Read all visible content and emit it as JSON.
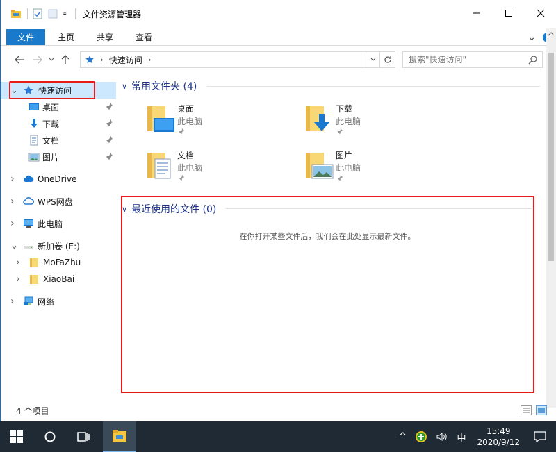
{
  "window": {
    "title": "文件资源管理器",
    "controls": {
      "minimize": "—",
      "maximize": "☐",
      "close": "✕"
    }
  },
  "ribbon": {
    "tabs": [
      "文件",
      "主页",
      "共享",
      "查看"
    ],
    "expand_glyph": "⌄",
    "help_glyph": "?"
  },
  "address": {
    "crumb": "快速访问",
    "search_placeholder": "搜索\"快速访问\""
  },
  "nav": {
    "items": [
      {
        "label": "快速访问",
        "icon": "star-icon",
        "chev": "⌄"
      },
      {
        "label": "桌面",
        "icon": "desktop-icon"
      },
      {
        "label": "下载",
        "icon": "download-icon"
      },
      {
        "label": "文档",
        "icon": "document-icon"
      },
      {
        "label": "图片",
        "icon": "picture-icon"
      },
      {
        "label": "OneDrive",
        "icon": "cloud-icon",
        "chev": "›"
      },
      {
        "label": "WPS网盘",
        "icon": "wps-cloud-icon",
        "chev": "›"
      },
      {
        "label": "此电脑",
        "icon": "pc-icon",
        "chev": "›"
      },
      {
        "label": "新加卷 (E:)",
        "icon": "drive-icon",
        "chev": "⌄"
      },
      {
        "label": "MoFaZhu",
        "icon": "folder-icon",
        "chev": "›"
      },
      {
        "label": "XiaoBai",
        "icon": "folder-icon",
        "chev": "›"
      },
      {
        "label": "网络",
        "icon": "network-icon",
        "chev": "›"
      }
    ]
  },
  "main": {
    "frequent_header": "常用文件夹 (4)",
    "recent_header": "最近使用的文件 (0)",
    "empty_message": "在你打开某些文件后，我们会在此处显示最新文件。",
    "tiles": [
      {
        "name": "桌面",
        "sub": "此电脑"
      },
      {
        "name": "下载",
        "sub": "此电脑"
      },
      {
        "name": "文档",
        "sub": "此电脑"
      },
      {
        "name": "图片",
        "sub": "此电脑"
      }
    ]
  },
  "status": {
    "count": "4 个项目"
  },
  "taskbar": {
    "time": "15:49",
    "date": "2020/9/12",
    "ime": "中",
    "tray_up": "^"
  },
  "colors": {
    "accent": "#1979ca",
    "highlight_red": "#e81b1b",
    "group_header": "#1e3287",
    "taskbar": "#1f2a34"
  }
}
